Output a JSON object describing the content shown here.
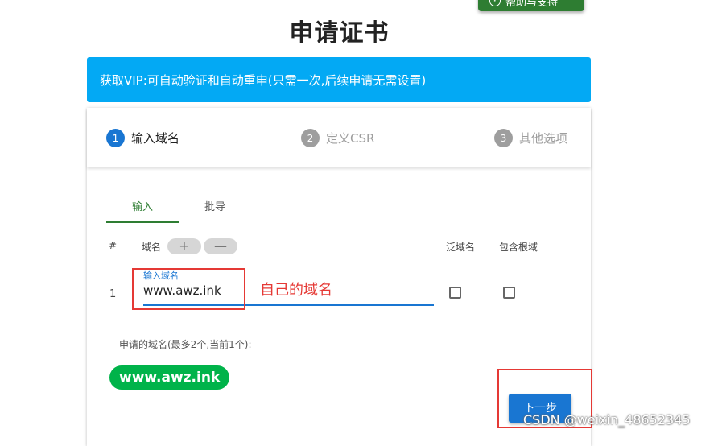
{
  "header": {
    "help_button_icon": "help-circle-icon",
    "help_button_label": "帮助与支持",
    "page_title": "申请证书"
  },
  "banner": {
    "text": "获取VIP:可自动验证和自动重申(只需一次,后续申请无需设置)",
    "color": "#03a9f4"
  },
  "stepper": {
    "steps": [
      {
        "number": "1",
        "label": "输入域名",
        "state": "active"
      },
      {
        "number": "2",
        "label": "定义CSR",
        "state": "inactive"
      },
      {
        "number": "3",
        "label": "其他选项",
        "state": "inactive"
      }
    ]
  },
  "tabs": [
    {
      "label": "输入",
      "active": true
    },
    {
      "label": "批导",
      "active": false
    }
  ],
  "table": {
    "headers": {
      "index": "#",
      "domain": "域名",
      "wildcard": "泛域名",
      "include_root": "包含根域"
    },
    "add_icon": "plus-icon",
    "remove_icon": "minus-icon",
    "add_symbol": "+",
    "remove_symbol": "—",
    "rows": [
      {
        "index": "1",
        "field_label": "输入域名",
        "value": "www.awz.ink",
        "wildcard_checked": false,
        "include_root_checked": false
      }
    ]
  },
  "applied": {
    "label": "申请的域名(最多2个,当前1个):",
    "domains": [
      "www.awz.ink"
    ],
    "chip_color": "#00b34a"
  },
  "next_button": {
    "label": "下一步"
  },
  "annotation": {
    "text": "自己的域名",
    "color": "#e53935"
  },
  "watermark": "CSDN @weixin_48652345",
  "colors": {
    "primary": "#1976d2",
    "help_button": "#2e7d32"
  }
}
